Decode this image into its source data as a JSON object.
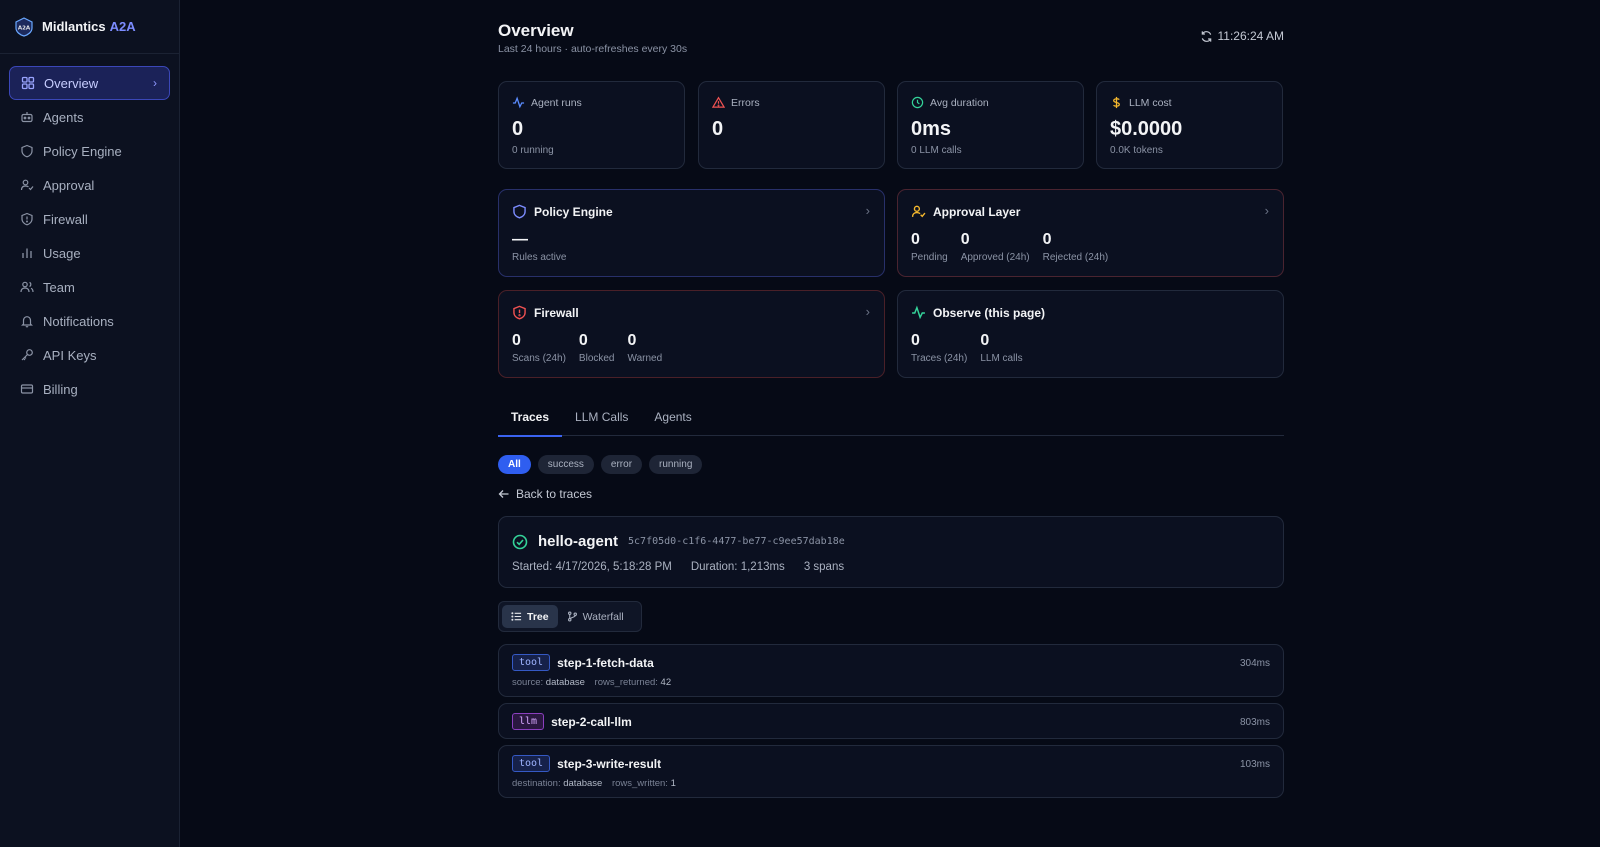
{
  "brand": {
    "name": "Midlantics",
    "accent": "A2A"
  },
  "sidebar": {
    "items": [
      {
        "label": "Overview",
        "icon": "grid-icon",
        "active": true
      },
      {
        "label": "Agents",
        "icon": "robot-icon"
      },
      {
        "label": "Policy Engine",
        "icon": "shield-icon"
      },
      {
        "label": "Approval",
        "icon": "user-check-icon"
      },
      {
        "label": "Firewall",
        "icon": "shield-alert-icon"
      },
      {
        "label": "Usage",
        "icon": "bar-chart-icon"
      },
      {
        "label": "Team",
        "icon": "users-icon"
      },
      {
        "label": "Notifications",
        "icon": "bell-icon"
      },
      {
        "label": "API Keys",
        "icon": "key-icon"
      },
      {
        "label": "Billing",
        "icon": "credit-card-icon"
      }
    ]
  },
  "header": {
    "title": "Overview",
    "subtitle": "Last 24 hours · auto-refreshes every 30s",
    "time": "11:26:24 AM"
  },
  "stats": [
    {
      "label": "Agent runs",
      "value": "0",
      "sub": "0 running",
      "icon": "activity-icon",
      "color": "#5b8cff"
    },
    {
      "label": "Errors",
      "value": "0",
      "sub": "",
      "icon": "warning-icon",
      "color": "#f05252"
    },
    {
      "label": "Avg duration",
      "value": "0ms",
      "sub": "0 LLM calls",
      "icon": "clock-icon",
      "color": "#34d399"
    },
    {
      "label": "LLM cost",
      "value": "$0.0000",
      "sub": "0.0K tokens",
      "icon": "dollar-icon",
      "color": "#f5b82e"
    }
  ],
  "modules": {
    "policy": {
      "title": "Policy Engine",
      "value": "—",
      "label": "Rules active"
    },
    "approval": {
      "title": "Approval Layer",
      "metrics": [
        {
          "value": "0",
          "label": "Pending"
        },
        {
          "value": "0",
          "label": "Approved (24h)"
        },
        {
          "value": "0",
          "label": "Rejected (24h)"
        }
      ]
    },
    "firewall": {
      "title": "Firewall",
      "metrics": [
        {
          "value": "0",
          "label": "Scans (24h)"
        },
        {
          "value": "0",
          "label": "Blocked"
        },
        {
          "value": "0",
          "label": "Warned"
        }
      ]
    },
    "observe": {
      "title": "Observe (this page)",
      "metrics": [
        {
          "value": "0",
          "label": "Traces (24h)"
        },
        {
          "value": "0",
          "label": "LLM calls"
        }
      ]
    }
  },
  "tabs": [
    "Traces",
    "LLM Calls",
    "Agents"
  ],
  "filters": [
    "All",
    "success",
    "error",
    "running"
  ],
  "back_label": "Back to traces",
  "trace": {
    "name": "hello-agent",
    "id": "5c7f05d0-c1f6-4477-be77-c9ee57dab18e",
    "started": "Started: 4/17/2026, 5:18:28 PM",
    "duration": "Duration: 1,213ms",
    "spans": "3 spans"
  },
  "view_toggle": {
    "tree": "Tree",
    "waterfall": "Waterfall"
  },
  "span_items": [
    {
      "type": "tool",
      "name": "step-1-fetch-data",
      "duration": "304ms",
      "attrs": [
        {
          "key": "source:",
          "value": "database"
        },
        {
          "key": "rows_returned:",
          "value": "42"
        }
      ]
    },
    {
      "type": "llm",
      "name": "step-2-call-llm",
      "duration": "803ms",
      "attrs": []
    },
    {
      "type": "tool",
      "name": "step-3-write-result",
      "duration": "103ms",
      "attrs": [
        {
          "key": "destination:",
          "value": "database"
        },
        {
          "key": "rows_written:",
          "value": "1"
        }
      ]
    }
  ]
}
